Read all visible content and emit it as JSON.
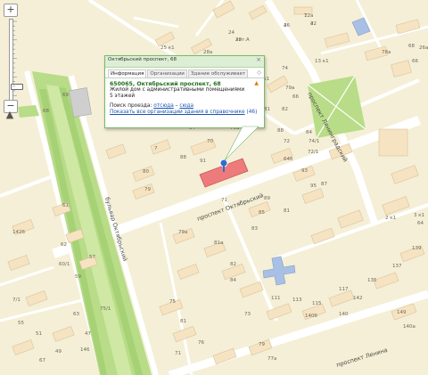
{
  "map": {
    "road_labels": {
      "oktyabrsky": "проспект Октябрьский",
      "leningradsky": "проспект Ленинградский",
      "oktyabrya_blvd": "бульвар Октябрьский",
      "lenina": "проспект Ленина"
    },
    "building_labels": [
      "12a",
      "42",
      "26",
      "28",
      "24",
      "25 к1",
      "28a",
      "78a",
      "68",
      "66",
      "26a",
      "13 к1",
      "74",
      "4 к1",
      "4a",
      "6a",
      "79а",
      "66",
      "81",
      "82",
      "88",
      "84",
      "6",
      "68",
      "66a",
      "64a",
      "64",
      "70",
      "70a",
      "74/1",
      "72",
      "72/1",
      "64б",
      "7",
      "88",
      "91",
      "93",
      "95",
      "87",
      "85",
      "89",
      "81",
      "71",
      "83",
      "2 к1",
      "3 к1",
      "64",
      "80",
      "79",
      "79a",
      "81a",
      "82",
      "84",
      "111",
      "113",
      "115",
      "117",
      "135",
      "137",
      "139",
      "149",
      "61",
      "60/1",
      "62",
      "7/1",
      "63",
      "59",
      "57",
      "55",
      "51",
      "49",
      "47",
      "75/1",
      "75",
      "81",
      "76",
      "71",
      "73",
      "79",
      "77a",
      "140б",
      "140",
      "142",
      "140a",
      "142б",
      "146",
      "67",
      "68",
      "69",
      "7",
      "2",
      "4",
      "лит.А"
    ]
  },
  "zoom": {
    "plus": "+",
    "minus": "−",
    "level_fraction": 0.86
  },
  "compass": {
    "glyph": "▲"
  },
  "popup": {
    "title": "Октябрьский проспект, 68",
    "close": "×",
    "tabs": [
      "Информация",
      "Организации",
      "Здание обслуживает"
    ],
    "tabs_arrow": "◇",
    "address_line": "650065, Октябрьский проспект, 68",
    "desc_line1": "Жилой дом с административными помещениями",
    "desc_line2": "5 этажей",
    "route_label": "Поиск проезда:",
    "route_from": "отсюда",
    "route_sep": "–",
    "route_to": "сюда",
    "orgs_link": "Показать все организации здания в справочнике",
    "orgs_count": "(46)",
    "warn_glyph": "▲"
  },
  "colors": {
    "background": "#f4efd6",
    "road": "#ffffff",
    "park": "#b8dc88",
    "park_inner": "#cfe8a4",
    "selected_building": "#ee7b7b",
    "popup_border": "#7bb86b"
  },
  "icons": {
    "marker": "map-marker-icon"
  }
}
